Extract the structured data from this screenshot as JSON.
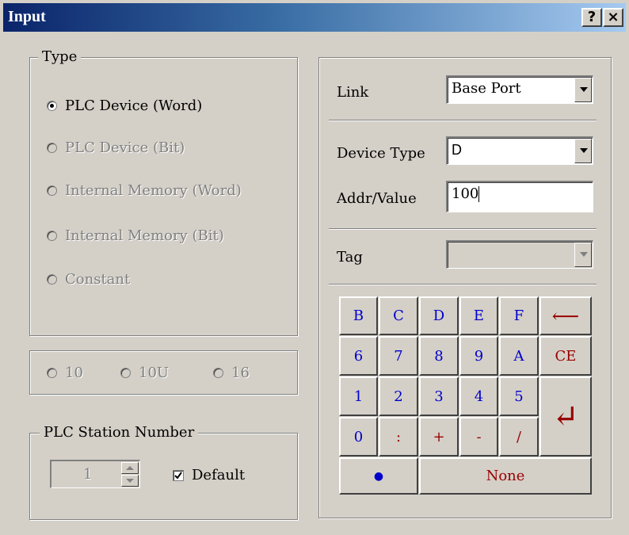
{
  "window": {
    "title": "Input",
    "help_button": "?",
    "close_button": "×"
  },
  "type_group": {
    "label": "Type",
    "options": [
      {
        "label": "PLC Device (Word)",
        "selected": true,
        "enabled": true
      },
      {
        "label": "PLC Device (Bit)",
        "selected": false,
        "enabled": false
      },
      {
        "label": "Internal Memory (Word)",
        "selected": false,
        "enabled": false
      },
      {
        "label": "Internal Memory (Bit)",
        "selected": false,
        "enabled": false
      },
      {
        "label": "Constant",
        "selected": false,
        "enabled": false
      }
    ]
  },
  "radix": {
    "options": [
      {
        "label": "10",
        "enabled": false
      },
      {
        "label": "10U",
        "enabled": false
      },
      {
        "label": "16",
        "enabled": false
      }
    ]
  },
  "station": {
    "label": "PLC Station Number",
    "value": "1",
    "default_label": "Default",
    "default_checked": true
  },
  "form": {
    "link_label": "Link",
    "link_value": "Base Port",
    "device_type_label": "Device Type",
    "device_type_value": "D",
    "addr_label": "Addr/Value",
    "addr_value": "100",
    "tag_label": "Tag",
    "tag_value": ""
  },
  "keypad": {
    "row1": [
      "B",
      "C",
      "D",
      "E",
      "F"
    ],
    "row2": [
      "6",
      "7",
      "8",
      "9",
      "A"
    ],
    "row3": [
      "1",
      "2",
      "3",
      "4",
      "5"
    ],
    "row4": [
      "0",
      ":",
      "+",
      "-",
      "/"
    ],
    "backspace": "⟵",
    "clear": "CE",
    "enter": "↵",
    "dot": "●",
    "none": "None"
  },
  "colors": {
    "face": "#d4d0c8",
    "title_start": "#0a246a",
    "title_end": "#a6caf0",
    "key_blue": "#0000cc",
    "key_red": "#990000"
  }
}
